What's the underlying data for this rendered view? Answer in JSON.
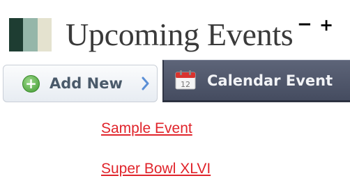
{
  "header": {
    "title": "Upcoming Events",
    "minus_label": "−",
    "plus_label": "+",
    "swatch_colors": [
      "#1e3d32",
      "#95b6a9",
      "#e4e2cf"
    ]
  },
  "toolbar": {
    "add_new_label": "Add New",
    "add_icon": "plus-circle-icon",
    "chevron_icon": "chevron-right-icon"
  },
  "tab": {
    "label": "Calendar Event",
    "icon": "calendar-icon",
    "calendar_day": "12"
  },
  "events": [
    {
      "title": "Sample Event"
    },
    {
      "title": "Super Bowl XLVI"
    }
  ],
  "colors": {
    "link": "#e0242b",
    "tab_bg": "#4f566a",
    "add_icon_green": "#4caf3a"
  }
}
